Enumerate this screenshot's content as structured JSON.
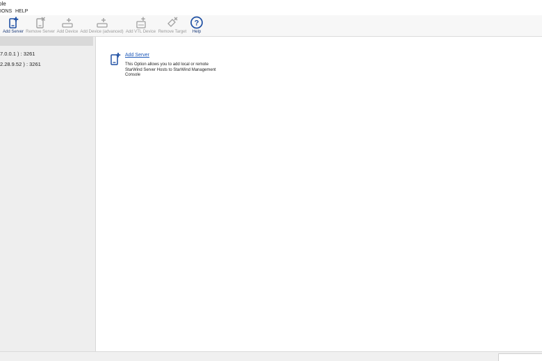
{
  "window": {
    "title_fragment": "ole"
  },
  "menu": {
    "items": [
      "IONS",
      "HELP"
    ]
  },
  "toolbar": {
    "buttons": [
      {
        "label": "Add Server",
        "icon": "add-server-icon",
        "enabled": true
      },
      {
        "label": "Remove Server",
        "icon": "remove-server-icon",
        "enabled": false
      },
      {
        "label": "Add Device",
        "icon": "add-device-icon",
        "enabled": false
      },
      {
        "label": "Add Device (advanced)",
        "icon": "add-device-advanced-icon",
        "enabled": false
      },
      {
        "label": "Add VTL Device",
        "icon": "add-vtl-device-icon",
        "enabled": false
      },
      {
        "label": "Remove Target",
        "icon": "remove-target-icon",
        "enabled": false
      },
      {
        "label": "Help",
        "icon": "help-icon",
        "enabled": true
      }
    ]
  },
  "tree": {
    "items": [
      {
        "label": "7.0.0.1 ) : 3261"
      },
      {
        "label": "2.28.9.52 ) : 3261"
      }
    ]
  },
  "main": {
    "action": {
      "title": "Add Server",
      "description": "This Option allows you to add local or remote StarWind Server Hosts to StarWind Management Console",
      "icon": "add-server-icon"
    }
  },
  "colors": {
    "accent": "#1a56b8",
    "icon_blue": "#1e4fa3",
    "disabled": "#a0a0a0"
  }
}
